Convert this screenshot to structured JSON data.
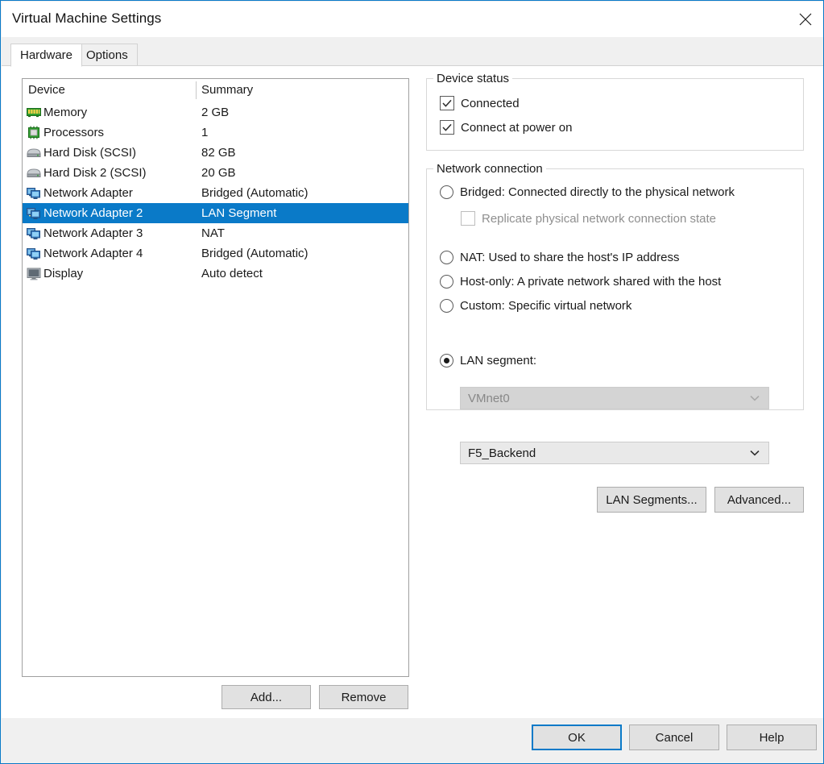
{
  "window": {
    "title": "Virtual Machine Settings",
    "close_icon": "close-icon",
    "accent_color": "#0a7ac8"
  },
  "tabs": [
    {
      "label": "Hardware",
      "active": true
    },
    {
      "label": "Options",
      "active": false
    }
  ],
  "device_list": {
    "columns": [
      "Device",
      "Summary"
    ],
    "selected_index": 5,
    "rows": [
      {
        "icon": "memory-icon",
        "name": "Memory",
        "summary": "2 GB"
      },
      {
        "icon": "processor-icon",
        "name": "Processors",
        "summary": "1"
      },
      {
        "icon": "harddisk-icon",
        "name": "Hard Disk (SCSI)",
        "summary": "82 GB"
      },
      {
        "icon": "harddisk-icon",
        "name": "Hard Disk 2 (SCSI)",
        "summary": "20 GB"
      },
      {
        "icon": "network-adapter-icon",
        "name": "Network Adapter",
        "summary": "Bridged (Automatic)"
      },
      {
        "icon": "network-adapter-icon",
        "name": "Network Adapter 2",
        "summary": "LAN Segment"
      },
      {
        "icon": "network-adapter-icon",
        "name": "Network Adapter 3",
        "summary": "NAT"
      },
      {
        "icon": "network-adapter-icon",
        "name": "Network Adapter 4",
        "summary": "Bridged (Automatic)"
      },
      {
        "icon": "display-icon",
        "name": "Display",
        "summary": "Auto detect"
      }
    ],
    "add_label": "Add...",
    "remove_label": "Remove"
  },
  "device_status": {
    "group_label": "Device status",
    "checkboxes": [
      {
        "label": "Connected",
        "checked": true,
        "disabled": false
      },
      {
        "label": "Connect at power on",
        "checked": true,
        "disabled": false
      }
    ]
  },
  "network_connection": {
    "group_label": "Network connection",
    "options": [
      {
        "label": "Bridged: Connected directly to the physical network",
        "selected": false
      },
      {
        "label": "NAT: Used to share the host's IP address",
        "selected": false
      },
      {
        "label": "Host-only: A private network shared with the host",
        "selected": false
      },
      {
        "label": "Custom: Specific virtual network",
        "selected": false
      },
      {
        "label": "LAN segment:",
        "selected": true
      }
    ],
    "replicate_checkbox": {
      "label": "Replicate physical network connection state",
      "checked": false,
      "disabled": true
    },
    "custom_network_combo": {
      "value": "VMnet0",
      "disabled": true
    },
    "lan_segment_combo": {
      "value": "F5_Backend",
      "disabled": false
    },
    "lan_segments_button": "LAN Segments...",
    "advanced_button": "Advanced..."
  },
  "footer": {
    "ok": "OK",
    "cancel": "Cancel",
    "help": "Help"
  }
}
